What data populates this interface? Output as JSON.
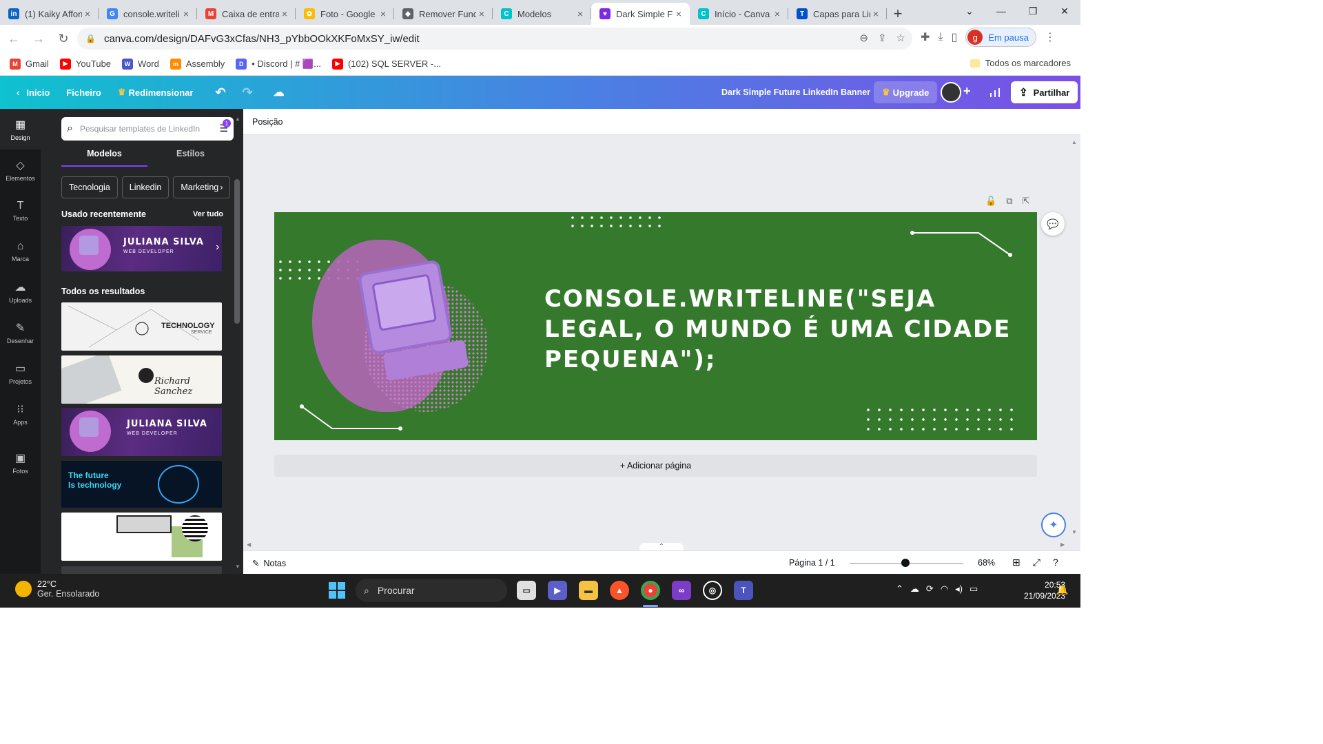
{
  "browser": {
    "tabs": [
      {
        "title": "(1) Kaiky Affon",
        "icon": "linkedin-icon",
        "color": "#0a66c2",
        "glyph": "in"
      },
      {
        "title": "console.writeli",
        "icon": "google-icon",
        "color": "#4285f4",
        "glyph": "G"
      },
      {
        "title": "Caixa de entra",
        "icon": "gmail-icon",
        "color": "#ea4335",
        "glyph": "M"
      },
      {
        "title": "Foto - Google",
        "icon": "google-photos-icon",
        "color": "#fbbc04",
        "glyph": "✿"
      },
      {
        "title": "Remover Fund",
        "icon": "remove-bg-icon",
        "color": "#5f6368",
        "glyph": "◆"
      },
      {
        "title": "Modelos",
        "icon": "canva-icon",
        "color": "#00c4cc",
        "glyph": "C"
      },
      {
        "title": "Dark Simple F",
        "icon": "canva-heart-icon",
        "color": "#7d2ae8",
        "glyph": "♥"
      },
      {
        "title": "Início - Canva",
        "icon": "canva-icon",
        "color": "#00c4cc",
        "glyph": "C"
      },
      {
        "title": "Capas para Lir",
        "icon": "trello-icon",
        "color": "#0052cc",
        "glyph": "T"
      }
    ],
    "active_tab": 6,
    "url": "canva.com/design/DAFvG3xCfas/NH3_pYbbOOkXKFoMxSY_iw/edit",
    "profile_initial": "g",
    "profile_label": "Em pausa",
    "bookmarks": [
      {
        "label": "Gmail",
        "icon": "gmail-icon",
        "color": "#ea4335",
        "glyph": "M"
      },
      {
        "label": "YouTube",
        "icon": "youtube-icon",
        "color": "#ff0000",
        "glyph": "▶"
      },
      {
        "label": "Word",
        "icon": "word-icon",
        "color": "#4b56c9",
        "glyph": "W"
      },
      {
        "label": "Assembly",
        "icon": "assembly-icon",
        "color": "#ff8c00",
        "glyph": "m"
      },
      {
        "label": "• Discord | # 🟪...",
        "icon": "discord-icon",
        "color": "#5865f2",
        "glyph": "D"
      },
      {
        "label": "(102) SQL SERVER -...",
        "icon": "youtube-icon",
        "color": "#ff0000",
        "glyph": "▶"
      }
    ],
    "all_bookmarks": "Todos os marcadores"
  },
  "canva": {
    "header": {
      "home": "Início",
      "file": "Ficheiro",
      "resize": "Redimensionar",
      "design_title": "Dark Simple Future LinkedIn Banner",
      "upgrade": "Upgrade",
      "share": "Partilhar"
    },
    "rail": [
      {
        "label": "Design",
        "icon": "design-icon",
        "glyph": "▦"
      },
      {
        "label": "Elementos",
        "icon": "elements-icon",
        "glyph": "◇"
      },
      {
        "label": "Texto",
        "icon": "text-icon",
        "glyph": "T"
      },
      {
        "label": "Marca",
        "icon": "brand-icon",
        "glyph": "⌂"
      },
      {
        "label": "Uploads",
        "icon": "uploads-icon",
        "glyph": "☁"
      },
      {
        "label": "Desenhar",
        "icon": "draw-icon",
        "glyph": "✎"
      },
      {
        "label": "Projetos",
        "icon": "projects-icon",
        "glyph": "▭"
      },
      {
        "label": "Apps",
        "icon": "apps-icon",
        "glyph": "⁝⁝"
      },
      {
        "label": "Fotos",
        "icon": "photos-icon",
        "glyph": "▣"
      }
    ],
    "panel": {
      "search_placeholder": "Pesquisar templates de LinkedIn",
      "filter_badge": "1",
      "tabs": [
        "Modelos",
        "Estilos"
      ],
      "chips": [
        "Tecnologia",
        "Linkedin",
        "Marketing"
      ],
      "recent_title": "Usado recentemente",
      "see_all": "Ver tudo",
      "all_results_title": "Todos os resultados",
      "templates": {
        "juliana_name": "JULIANA SILVA",
        "juliana_role": "WEB DEVELOPER",
        "tech_title": "TECHNOLOGY",
        "tech_sub": "SERVICE",
        "signature": "Richard Sanchez",
        "future_line1": "The future",
        "future_line2": "Is technology"
      }
    },
    "toolbar_label": "Posição",
    "banner": {
      "quote": "CONSOLE.WRITELINE(\"SEJA LEGAL, O MUNDO É UMA CIDADE PEQUENA\");",
      "background": "#357a2c"
    },
    "add_page": "+ Adicionar página",
    "footer": {
      "notes": "Notas",
      "page": "Página 1 / 1",
      "zoom": "68%"
    }
  },
  "taskbar": {
    "temperature": "22°C",
    "weather": "Ger. Ensolarado",
    "search": "Procurar",
    "time": "20:53",
    "date": "21/09/2023"
  }
}
